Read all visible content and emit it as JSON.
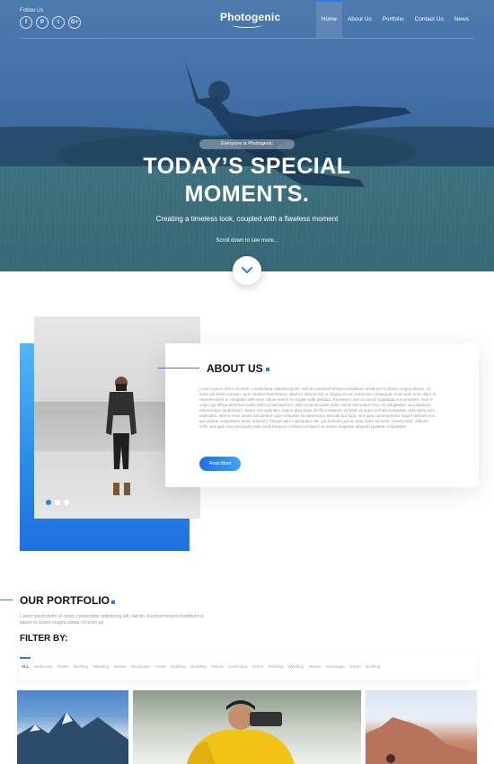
{
  "header": {
    "follow_label": "Follow Us",
    "socials": [
      {
        "icon": "facebook-icon",
        "glyph": "f"
      },
      {
        "icon": "pinterest-icon",
        "glyph": "P"
      },
      {
        "icon": "twitter-icon",
        "glyph": "t"
      },
      {
        "icon": "google-plus-icon",
        "glyph": "G+"
      }
    ],
    "logo": "Photogenic",
    "nav": [
      "Home",
      "About Us",
      "Portfolio",
      "Contact Us",
      "News"
    ],
    "active_nav": "Home"
  },
  "hero": {
    "badge": "Everyone is Photogenic",
    "headline_line1": "TODAY’S SPECIAL",
    "headline_line2": "MOMENTS.",
    "subline": "Creating a timeless look, coupled with a flawless moment",
    "scroll_note": "Scroll down to see more..."
  },
  "about": {
    "title": "ABOUT US",
    "text": "Lorem ipsum dolor sit amet, consectetur adipisicing elit, sed do eiusmod tempor incididunt ut labore et dolore magna aliqua. Ut enim ad minim veniam, quis nostrud exercitation ullamco laboris nisi ut aliquip ex ea commodo consequat. Duis aute irure dolor in reprehenderit in voluptate velit esse cillum dolore eu fugiat nulla pariatur. Excepteur sint occaecat cupidatat non proident, sunt in culpa qui officia deserunt mollit anim id est laborum. Sed ut perspiciatis unde omnis iste natus error sit voluptatem accusantium doloremque laudantium, totam rem aperiam, eaque ipsa quae ab illo inventore veritatis et quasi architecto beatae vitae dicta sunt explicabo. Nemo enim ipsam voluptatem quia voluptas sit aspernatur aut odit aut fugit, sed quia consequuntur magni dolores eos qui ratione voluptatem sequi nesciunt. Neque porro quisquam est, qui dolorem ipsum quia dolor sit amet, consectetur, adipisci velit, sed quia non numquam eius modi tempora incidunt ut labore et dolore magnam aliquam quaerat voluptatem.",
    "read_more": "Read More",
    "slide_count": 3,
    "active_slide": 1
  },
  "portfolio": {
    "title": "OUR PORTFOLIO",
    "text": "Lorem ipsum dolor sit amet, consectetur adipisicing elit, sed do eiusmod tempor incididunt ut labore et dolore magna aliqua. Ut enim ad",
    "filter_title": "FILTER BY:",
    "filters": [
      "ALL",
      "landscape",
      "Green",
      "Building",
      "Wedding",
      "Nature",
      "landscape",
      "Green",
      "Building",
      "Wedding",
      "Nature",
      "landscape",
      "Green",
      "Building",
      "Wedding",
      "Nature",
      "landscape",
      "Green",
      "Building"
    ],
    "active_filter": "ALL"
  },
  "colors": {
    "accent": "#2f7de0",
    "accent_light": "#3ea5f3"
  }
}
